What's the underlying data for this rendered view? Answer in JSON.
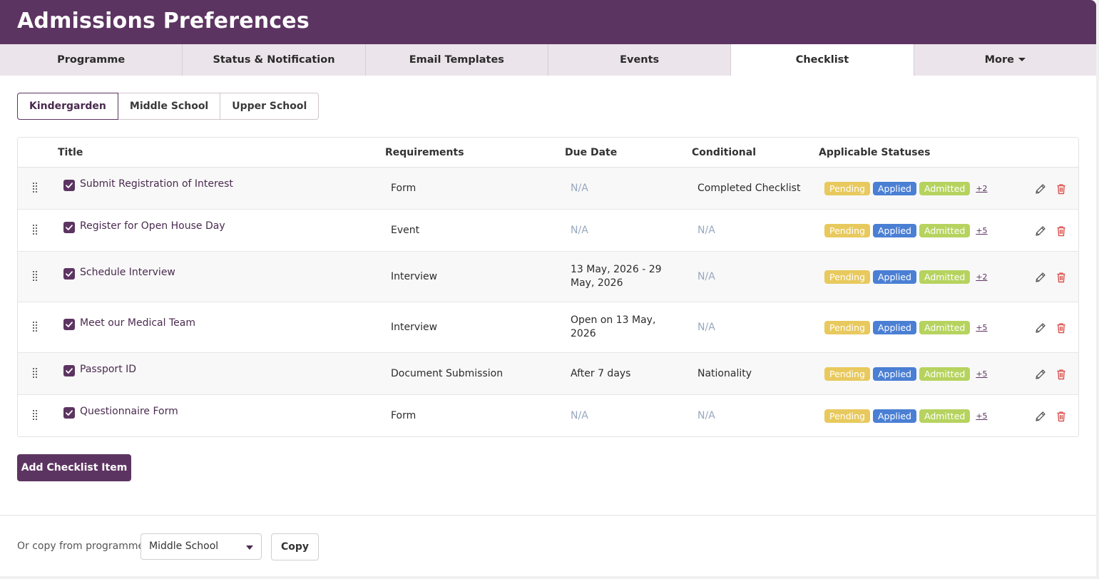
{
  "header": {
    "title": "Admissions Preferences"
  },
  "tabs": [
    {
      "label": "Programme"
    },
    {
      "label": "Status & Notification"
    },
    {
      "label": "Email Templates"
    },
    {
      "label": "Events"
    },
    {
      "label": "Checklist",
      "active": true
    },
    {
      "label": "More"
    }
  ],
  "segments": [
    {
      "label": "Kindergarden",
      "active": true
    },
    {
      "label": "Middle School"
    },
    {
      "label": "Upper School"
    }
  ],
  "table": {
    "headers": {
      "title": "Title",
      "requirements": "Requirements",
      "due_date": "Due Date",
      "conditional": "Conditional",
      "statuses": "Applicable Statuses"
    },
    "rows": [
      {
        "title": "Submit Registration of Interest",
        "requirement": "Form",
        "due_1": "N/A",
        "due_2": "",
        "conditional": "Completed Checklist",
        "checked": true,
        "badges": [
          "Pending",
          "Applied",
          "Admitted"
        ],
        "more": "+2"
      },
      {
        "title": "Register for Open House Day",
        "requirement": "Event",
        "due_1": "N/A",
        "due_2": "",
        "conditional": "N/A",
        "checked": true,
        "badges": [
          "Pending",
          "Applied",
          "Admitted"
        ],
        "more": "+5"
      },
      {
        "title": "Schedule Interview",
        "requirement": "Interview",
        "due_1": "13 May, 2026 - 29",
        "due_2": "May, 2026",
        "conditional": "N/A",
        "checked": true,
        "badges": [
          "Pending",
          "Applied",
          "Admitted"
        ],
        "more": "+2"
      },
      {
        "title": "Meet our Medical Team",
        "requirement": "Interview",
        "due_1": "Open on 13 May,",
        "due_2": "2026",
        "conditional": "N/A",
        "checked": true,
        "badges": [
          "Pending",
          "Applied",
          "Admitted"
        ],
        "more": "+5"
      },
      {
        "title": "Passport ID",
        "requirement": "Document Submission",
        "due_1": "After 7 days",
        "due_2": "",
        "conditional": "Nationality",
        "checked": true,
        "badges": [
          "Pending",
          "Applied",
          "Admitted"
        ],
        "more": "+5"
      },
      {
        "title": "Questionnaire Form",
        "requirement": "Form",
        "due_1": "N/A",
        "due_2": "",
        "conditional": "N/A",
        "checked": true,
        "badges": [
          "Pending",
          "Applied",
          "Admitted"
        ],
        "more": "+5"
      }
    ]
  },
  "actions": {
    "add_label": "Add Checklist Item"
  },
  "copy": {
    "label": "Or copy from programme",
    "selected": "Middle School",
    "button": "Copy"
  },
  "colors": {
    "brand": "#5c3461",
    "pending": "#e8c95d",
    "applied": "#4a7fd4",
    "admitted": "#b6d35f",
    "delete": "#d9534f"
  },
  "icons": {
    "row_handle": "drag-handle-icon",
    "edit": "pencil-icon",
    "delete": "trash-icon",
    "checkbox": "check-icon",
    "more_tab": "caret-down-icon"
  }
}
